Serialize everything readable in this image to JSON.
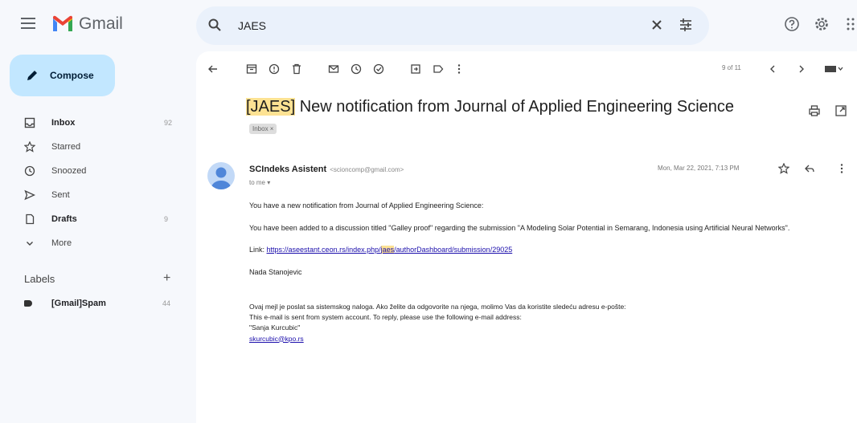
{
  "app": {
    "name": "Gmail"
  },
  "search": {
    "query": "JAES"
  },
  "compose": {
    "label": "Compose"
  },
  "nav": [
    {
      "label": "Inbox",
      "count": "92",
      "icon": "inbox-icon",
      "bold": true
    },
    {
      "label": "Starred",
      "count": "",
      "icon": "star-icon"
    },
    {
      "label": "Snoozed",
      "count": "",
      "icon": "clock-icon"
    },
    {
      "label": "Sent",
      "count": "",
      "icon": "send-icon"
    },
    {
      "label": "Drafts",
      "count": "9",
      "icon": "draft-icon",
      "bold": true
    },
    {
      "label": "More",
      "count": "",
      "icon": "chevron-down-icon"
    }
  ],
  "labels": {
    "heading": "Labels",
    "items": [
      {
        "label": "[Gmail]Spam",
        "count": "44"
      }
    ]
  },
  "toolbar": {
    "pager": "9 of 11"
  },
  "email": {
    "subject_tag": "[JAES]",
    "subject_rest": " New notification from Journal of Applied Engineering Science",
    "chip": "Inbox ×",
    "sender_name": "SCIndeks Asistent",
    "sender_email": "<scioncomp@gmail.com>",
    "to": "to me ▾",
    "date": "Mon, Mar 22, 2021, 7:13 PM",
    "p1": "You have a new notification from Journal of Applied Engineering Science:",
    "p2": "You have been added to a discussion titled \"Galley proof\" regarding the submission \"A Modeling Solar Potential in Semarang, Indonesia using Artificial Neural Networks\".",
    "link_label": "Link: ",
    "link_pre": "https://aseestant.ceon.rs/index.php/",
    "link_hl": "jaes",
    "link_post": "/authorDashboard/submission/29025",
    "p4": "Nada Stanojevic",
    "sig1": "Ovaj mejl je poslat sa sistemskog naloga. Ako želite da odgovorite na njega, molimo Vas da koristite sledeću adresu e-pošte:",
    "sig2": "This e-mail is sent from system account. To reply, please use the following e-mail address:",
    "sig3": "\"Sanja Kurcubic\"",
    "sig4": "skurcubic@kpo.rs"
  },
  "colors": {
    "compose_bg": "#c2e7ff",
    "search_bg": "#eaf1fb",
    "highlight": "#fde293",
    "link": "#1a0dab"
  }
}
